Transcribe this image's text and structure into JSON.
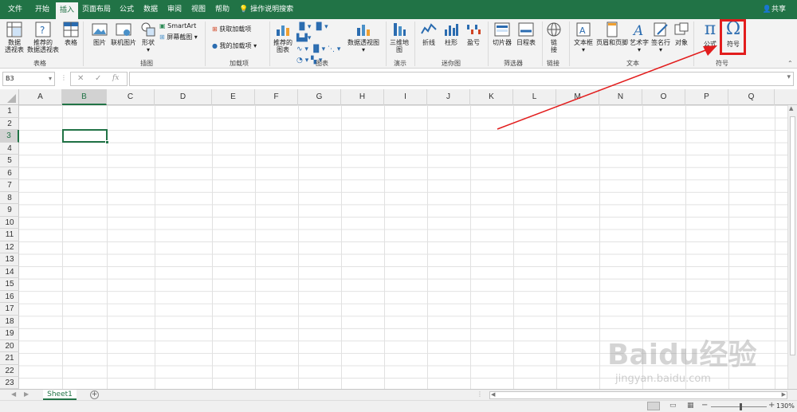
{
  "tabs": [
    "文件",
    "开始",
    "插入",
    "页面布局",
    "公式",
    "数据",
    "审阅",
    "视图",
    "帮助"
  ],
  "active_tab": "插入",
  "tell_me": "操作说明搜索",
  "share": "共享",
  "ribbon": {
    "tables": {
      "pivot_line1": "数据",
      "pivot_line2": "透视表",
      "rec_line1": "推荐的",
      "rec_line2": "数据透视表",
      "table": "表格",
      "label": "表格"
    },
    "illustrations": {
      "picture": "图片",
      "online": "联机图片",
      "shapes": "形状",
      "smartart": "SmartArt",
      "screenshot": "屏幕截图",
      "label": "插图"
    },
    "addins": {
      "get": "获取加载项",
      "my": "我的加载项",
      "label": "加载项"
    },
    "charts": {
      "rec_line1": "推荐的",
      "rec_line2": "图表",
      "pivotchart": "数据透视图",
      "label": "图表"
    },
    "tours": {
      "map_line1": "三维地",
      "map_line2": "图",
      "label": "演示"
    },
    "sparklines": {
      "line": "折线",
      "column": "柱形",
      "winloss": "盈亏",
      "label": "迷你图"
    },
    "filters": {
      "slicer": "切片器",
      "timeline": "日程表",
      "label": "筛选器"
    },
    "links": {
      "link_line1": "链",
      "link_line2": "接",
      "label": "链接"
    },
    "text": {
      "textbox": "文本框",
      "headerfooter": "页眉和页脚",
      "wordart": "艺术字",
      "signature": "签名行",
      "object": "对象",
      "label": "文本"
    },
    "symbols": {
      "equation": "公式",
      "symbol": "符号",
      "label": "符号"
    }
  },
  "namebox": "B3",
  "columns": [
    "A",
    "B",
    "C",
    "D",
    "E",
    "F",
    "G",
    "H",
    "I",
    "J",
    "K",
    "L",
    "M",
    "N",
    "O",
    "P",
    "Q"
  ],
  "rows": [
    "1",
    "2",
    "3",
    "4",
    "5",
    "6",
    "7",
    "8",
    "9",
    "10",
    "11",
    "12",
    "13",
    "14",
    "15",
    "16",
    "17",
    "18",
    "19",
    "20",
    "21",
    "22",
    "23"
  ],
  "selected_cell": {
    "col": "B",
    "row": "3"
  },
  "sheet_tab": "Sheet1",
  "zoom": "130%",
  "watermark": "Baidu经验",
  "watermark_url": "jingyan.baidu.com",
  "colors": {
    "brand": "#217346",
    "highlight": "#e21d1d"
  }
}
